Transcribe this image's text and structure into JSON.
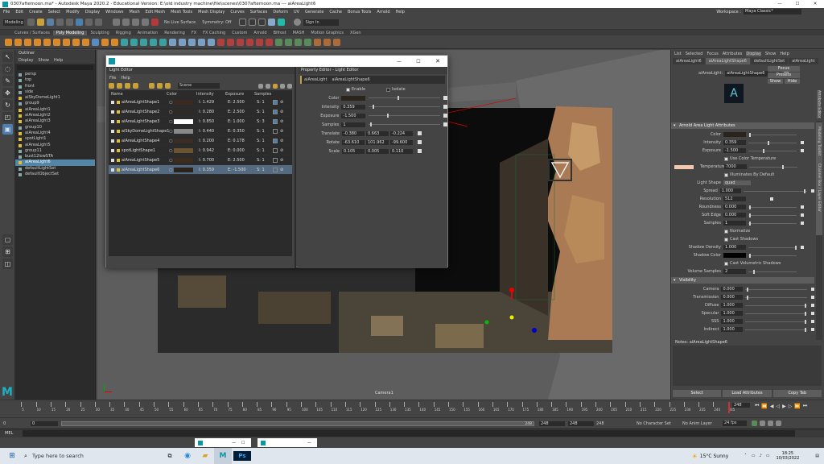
{
  "window": {
    "title": "0307afternoon.ma* - Autodesk Maya 2020.2 - Educational Version: E:\\old industry machine\\file\\scenes\\0307afternoon.ma  ---  aiAreaLight6",
    "minimize": "—",
    "maximize": "☐",
    "close": "✕"
  },
  "menus": [
    "File",
    "Edit",
    "Create",
    "Select",
    "Modify",
    "Display",
    "Windows",
    "Mesh",
    "Edit Mesh",
    "Mesh Tools",
    "Mesh Display",
    "Curves",
    "Surfaces",
    "Deform",
    "UV",
    "Generate",
    "Cache",
    "Bonus Tools",
    "Arnold",
    "Help"
  ],
  "workspace": {
    "label": "Workspace :",
    "value": "Maya Classic*"
  },
  "status": {
    "mode": "Modeling",
    "no_live_surface": "No Live Surface",
    "symmetry": "Symmetry: Off",
    "sign_in": "Sign In"
  },
  "shelf_tabs": [
    "Curves / Surfaces",
    "Poly Modeling",
    "Sculpting",
    "Rigging",
    "Animation",
    "Rendering",
    "FX",
    "FX Caching",
    "Custom",
    "Arnold",
    "Bifrost",
    "MASH",
    "Motion Graphics",
    "XGen"
  ],
  "shelf_active": "Poly Modeling",
  "outliner": {
    "title": "Outliner",
    "menus": [
      "Display",
      "Show",
      "Help"
    ],
    "items": [
      {
        "name": "persp",
        "sel": false
      },
      {
        "name": "top",
        "sel": false
      },
      {
        "name": "front",
        "sel": false
      },
      {
        "name": "side",
        "sel": false
      },
      {
        "name": "aiSkyDomeLight1",
        "sel": false
      },
      {
        "name": "group9",
        "sel": false
      },
      {
        "name": "aiAreaLight1",
        "sel": false
      },
      {
        "name": "aiAreaLight2",
        "sel": false
      },
      {
        "name": "aiAreaLight3",
        "sel": false
      },
      {
        "name": "group10",
        "sel": false
      },
      {
        "name": "aiAreaLight4",
        "sel": false
      },
      {
        "name": "spotLight1",
        "sel": false
      },
      {
        "name": "aiAreaLight5",
        "sel": false
      },
      {
        "name": "group11",
        "sel": false
      },
      {
        "name": "bust12lowSTA",
        "sel": false
      },
      {
        "name": "aiAreaLight6",
        "sel": true
      },
      {
        "name": "defaultLightSet",
        "sel": false
      },
      {
        "name": "defaultObjectSet",
        "sel": false
      }
    ]
  },
  "light_editor": {
    "title": "Light Editor",
    "tab": "Light Editor",
    "menus": [
      "File",
      "Help"
    ],
    "dropdown": "Scene",
    "columns": [
      "Name",
      "Color",
      "Intensity",
      "Exposure",
      "Samples"
    ],
    "rows": [
      {
        "name": "aiAreaLightShape1",
        "swatch": "#3a2a20",
        "intensity": "I: 1.429",
        "exposure": "E: 2.500",
        "samples": "S: 1",
        "sel": false
      },
      {
        "name": "aiAreaLightShape2",
        "swatch": "#2e2a26",
        "intensity": "I: 0.280",
        "exposure": "E: 2.500",
        "samples": "S: 1",
        "sel": false
      },
      {
        "name": "aiAreaLightShape3",
        "swatch": "#ffffff",
        "intensity": "I: 0.850",
        "exposure": "E: 1.000",
        "samples": "S: 3",
        "sel": false
      },
      {
        "name": "aiSkyDomeLightShape1",
        "swatch": "#888888",
        "intensity": "I: 0.440",
        "exposure": "E: 0.350",
        "samples": "S: 1",
        "sel": false
      },
      {
        "name": "aiAreaLightShape4",
        "swatch": "#3a2e24",
        "intensity": "I: 0.200",
        "exposure": "E: 0.178",
        "samples": "S: 1",
        "sel": false
      },
      {
        "name": "spotLightShape1",
        "swatch": "#6a5430",
        "intensity": "I: 0.942",
        "exposure": "E: 0.000",
        "samples": "S: 1",
        "sel": false
      },
      {
        "name": "aiAreaLightShape5",
        "swatch": "#3d2b1c",
        "intensity": "I: 0.700",
        "exposure": "E: 2.500",
        "samples": "S: 1",
        "sel": false
      },
      {
        "name": "aiAreaLightShape6",
        "swatch": "#2a241c",
        "intensity": "I: 0.359",
        "exposure": "E: -1.500",
        "samples": "S: 1",
        "sel": true
      }
    ]
  },
  "property_editor": {
    "tab": "Property Editor - Light Editor",
    "name_label": "aiAreaLight",
    "name_value": "aiAreaLightShape6",
    "enable": "Enable",
    "isolate": "Isolate",
    "color": "Color",
    "intensity_label": "Intensity",
    "intensity": "0.359",
    "exposure_label": "Exposure",
    "exposure": "-1.500",
    "samples_label": "Samples",
    "samples": "1",
    "translate_label": "Translate",
    "translate": [
      "-0.380",
      "0.663",
      "-0.224"
    ],
    "rotate_label": "Rotate",
    "rotate": [
      "-63.610",
      "101.962",
      "-99.600"
    ],
    "scale_label": "Scale",
    "scale": [
      "0.105",
      "0.005",
      "0.110"
    ]
  },
  "viewport": {
    "camera_label": "Camera1"
  },
  "attribute_editor": {
    "menus": [
      "List",
      "Selected",
      "Focus",
      "Attributes",
      "Display",
      "Show",
      "Help"
    ],
    "tabs": [
      "aiAreaLight6",
      "aiAreaLightShape6",
      "defaultLightSet",
      "aiAreaLight"
    ],
    "node_label": "aiAreaLight:",
    "node_value": "aiAreaLightShape6",
    "focus": "Focus",
    "presets": "Presets",
    "show": "Show",
    "hide": "Hide",
    "section1": "Arnold Area Light Attributes",
    "color": "Color",
    "intensity_label": "Intensity",
    "intensity": "0.359",
    "exposure_label": "Exposure",
    "exposure": "-1.500",
    "use_color_temp": "Use Color Temperature",
    "temperature_label": "Temperature",
    "temperature": "7000",
    "illuminates_default": "Illuminates By Default",
    "light_shape_label": "Light Shape",
    "light_shape": "quad",
    "spread_label": "Spread",
    "spread": "1.000",
    "resolution_label": "Resolution",
    "resolution": "512",
    "roundness_label": "Roundness",
    "roundness": "0.000",
    "soft_edge_label": "Soft Edge",
    "soft_edge": "0.000",
    "samples_label": "Samples",
    "samples": "1",
    "normalize": "Normalize",
    "cast_shadows": "Cast Shadows",
    "shadow_density_label": "Shadow Density",
    "shadow_density": "1.000",
    "shadow_color_label": "Shadow Color",
    "cast_volumetric": "Cast Volumetric Shadows",
    "volume_samples_label": "Volume Samples",
    "volume_samples": "2",
    "section2": "Visibility",
    "camera_label": "Camera",
    "camera": "0.000",
    "transmission_label": "Transmission",
    "transmission": "0.000",
    "diffuse_label": "Diffuse",
    "diffuse": "1.000",
    "specular_label": "Specular",
    "specular": "1.000",
    "sss_label": "SSS",
    "sss": "1.000",
    "indirect_label": "Indirect",
    "indirect": "1.000",
    "notes": "Notes:  aiAreaLightShape6",
    "select_btn": "Select",
    "load_btn": "Load Attributes",
    "copy_btn": "Copy Tab",
    "side_tabs": [
      "Attribute Editor",
      "Modeling Toolkit",
      "Channel Box / Layer Editor"
    ]
  },
  "timeline": {
    "ticks": [
      "5",
      "10",
      "15",
      "20",
      "25",
      "30",
      "35",
      "40",
      "45",
      "50",
      "55",
      "60",
      "65",
      "70",
      "75",
      "80",
      "85",
      "90",
      "95",
      "100",
      "105",
      "110",
      "115",
      "120",
      "125",
      "130",
      "135",
      "140",
      "145",
      "150",
      "155",
      "160",
      "165",
      "170",
      "175",
      "180",
      "185",
      "190",
      "195",
      "200",
      "205",
      "210",
      "215",
      "220",
      "225",
      "230",
      "235",
      "240",
      "245"
    ],
    "current": "248",
    "range_start": "0",
    "range_inner_start": "0",
    "range_inner_end": "248",
    "range_end": "248",
    "range_end2": "248",
    "range_end3": "248",
    "no_char": "No Character Set",
    "no_anim_layer": "No Anim Layer",
    "fps": "24 fps"
  },
  "cmd": {
    "label": "MEL"
  },
  "floating_windows": [
    {
      "title": ""
    },
    {
      "title": ""
    }
  ],
  "taskbar": {
    "search": "Type here to search",
    "weather": "15°C  Sunny",
    "time": "18:25",
    "date": "10/03/2022"
  }
}
